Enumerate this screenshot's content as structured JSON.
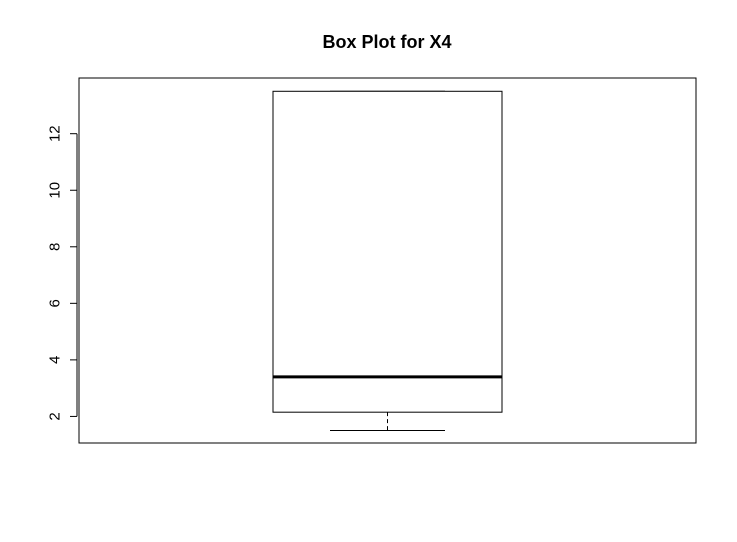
{
  "chart_data": {
    "type": "box",
    "title": "Box Plot for X4",
    "xlabel": "",
    "ylabel": "",
    "y_ticks": [
      2,
      4,
      6,
      8,
      10,
      12
    ],
    "y_tick_labels": [
      "2",
      "4",
      "6",
      "8",
      "10",
      "12"
    ],
    "ylim": [
      1.06,
      13.97
    ],
    "grid": false,
    "series": [
      {
        "min": 1.5,
        "q1": 2.15,
        "median": 3.4,
        "q3": 13.5,
        "max": 13.5
      }
    ],
    "colors": {
      "stroke": "#000000",
      "fill": "#ffffff"
    }
  }
}
